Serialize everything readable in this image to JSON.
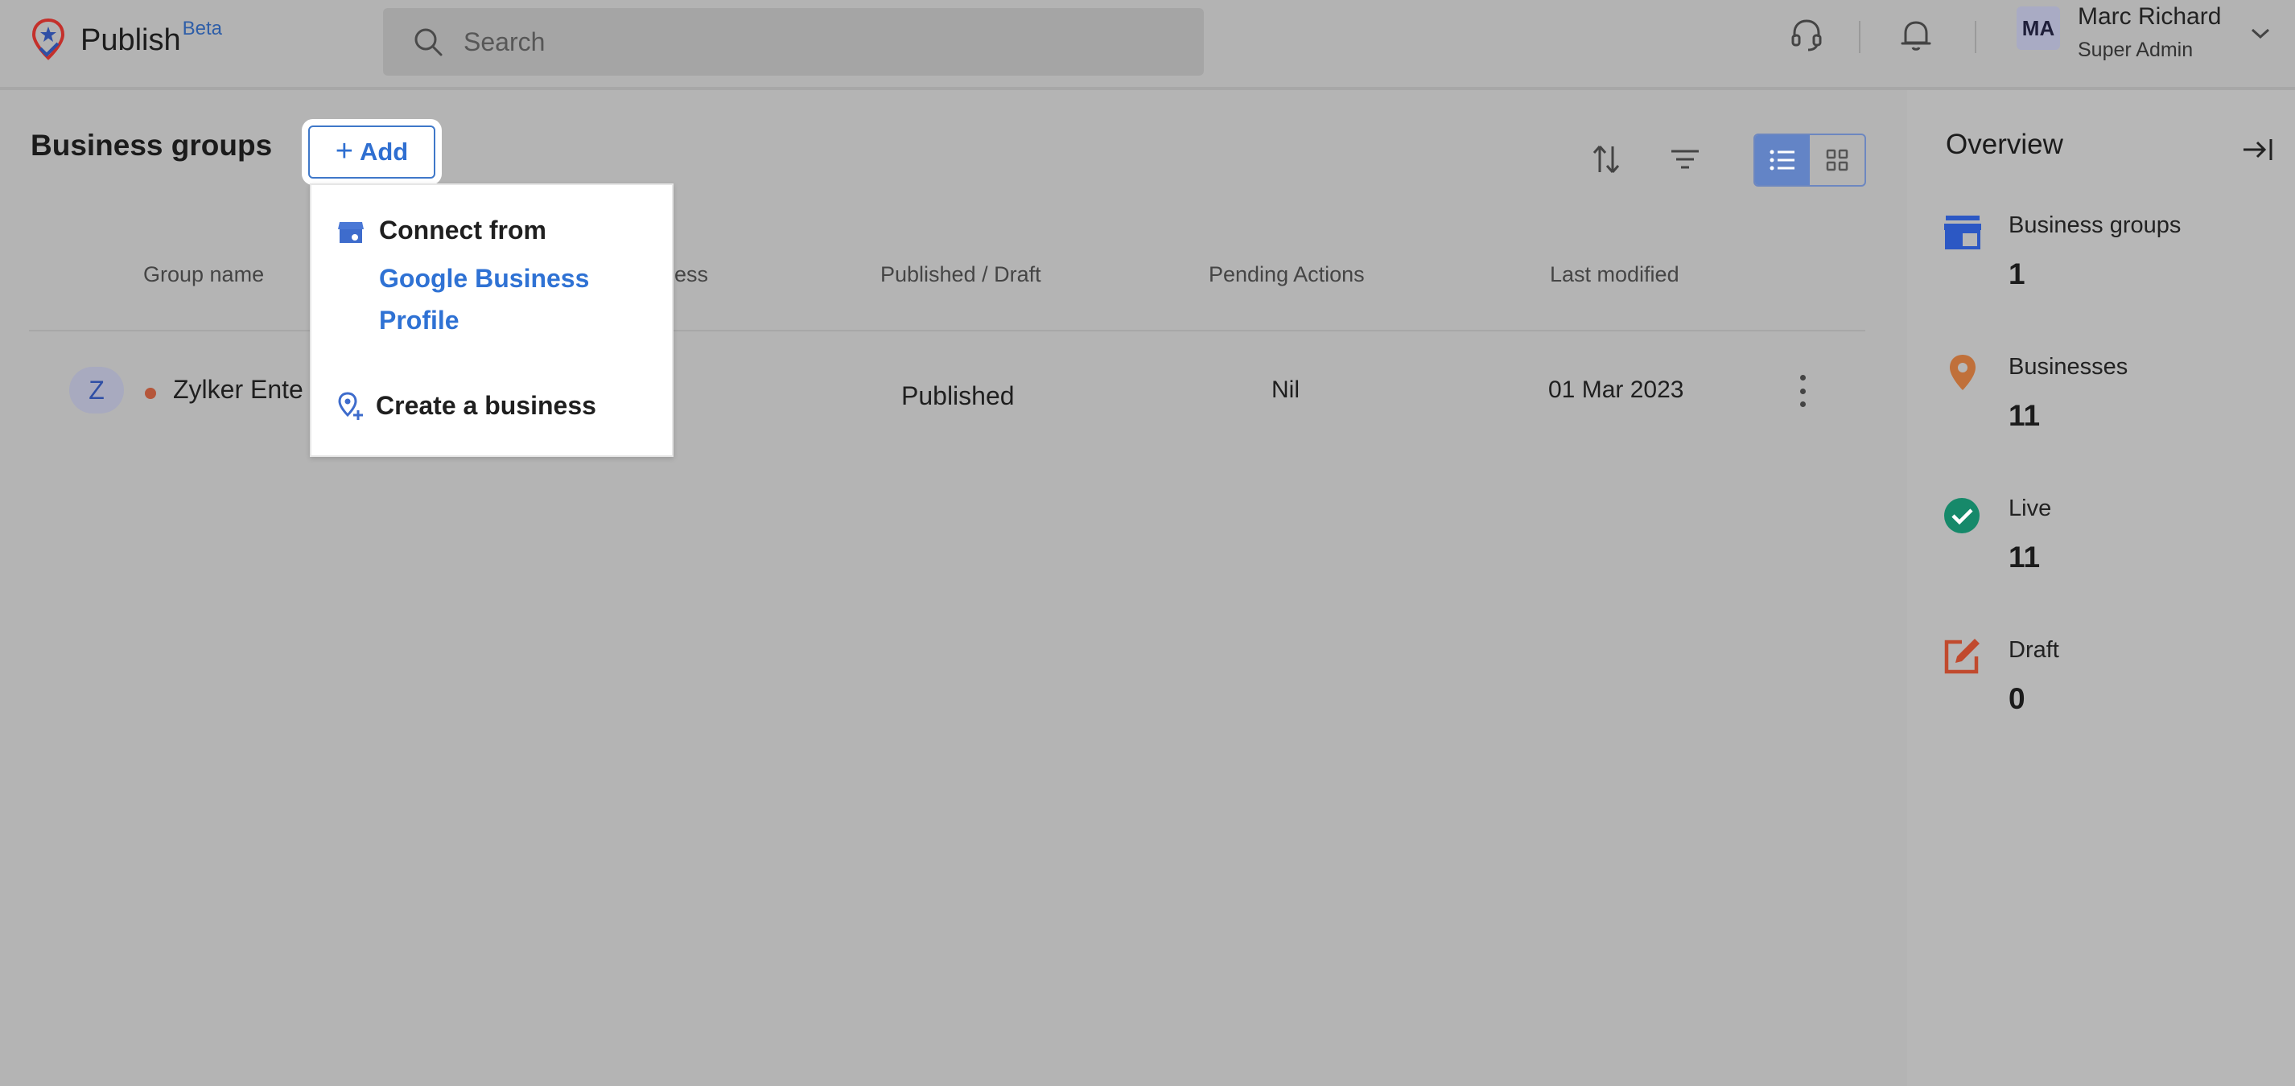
{
  "app": {
    "name": "Publish",
    "badge": "Beta"
  },
  "search": {
    "placeholder": "Search"
  },
  "user": {
    "initials": "MA",
    "name": "Marc Richard",
    "role": "Super Admin"
  },
  "page": {
    "title": "Business groups",
    "add_label": "Add"
  },
  "dropdown": {
    "connect_line1": "Connect from",
    "connect_line2": "Google Business Profile",
    "create_label": "Create a business"
  },
  "table": {
    "columns": [
      "Group name",
      "ess",
      "Published / Draft",
      "Pending Actions",
      "Last modified"
    ],
    "rows": [
      {
        "initial": "Z",
        "name": "Zylker Ente",
        "status": "Published",
        "pending": "Nil",
        "modified": "01 Mar 2023"
      }
    ]
  },
  "overview": {
    "title": "Overview",
    "stats": [
      {
        "label": "Business groups",
        "value": "1",
        "icon": "store-icon",
        "color": "#2c58c4"
      },
      {
        "label": "Businesses",
        "value": "11",
        "icon": "location-pin-icon",
        "color": "#c0703a"
      },
      {
        "label": "Live",
        "value": "11",
        "icon": "check-circle-icon",
        "color": "#16896a"
      },
      {
        "label": "Draft",
        "value": "0",
        "icon": "edit-icon",
        "color": "#c14a2e"
      }
    ]
  },
  "colors": {
    "accent": "#2f6fd1",
    "status_dot": "#b5563a"
  }
}
